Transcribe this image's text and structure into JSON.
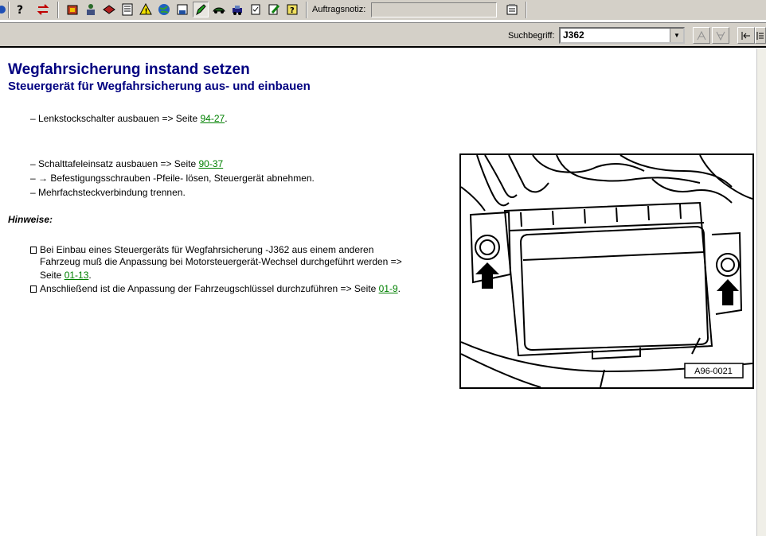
{
  "toolbar": {
    "auftragsnotiz_label": "Auftragsnotiz:",
    "auftragsnotiz_value": "",
    "icons": [
      "help-icon",
      "swap-icon",
      "box-icon",
      "person-icon",
      "book-icon",
      "document-icon",
      "warning-icon",
      "globe-icon",
      "save-icon",
      "pen-icon",
      "car-icon",
      "vehicle-icon",
      "checklist-icon",
      "edit-icon",
      "note-help-icon"
    ]
  },
  "search": {
    "label": "Suchbegriff:",
    "value": "J362"
  },
  "content": {
    "title": "Wegfahrsicherung instand setzen",
    "subtitle": "Steuergerät für Wegfahrsicherung aus- und einbauen",
    "steps": [
      {
        "text": "– Lenkstockschalter ausbauen => Seite ",
        "link": "94-27",
        "after": "."
      },
      {
        "text": "– Schalttafeleinsatz ausbauen => Seite ",
        "link": "90-37",
        "after": ""
      },
      {
        "text": "– → Befestigungsschrauben -Pfeile- lösen, Steuergerät abnehmen.",
        "link": "",
        "after": ""
      },
      {
        "text": "– Mehrfachsteckverbindung trennen.",
        "link": "",
        "after": ""
      }
    ],
    "hinweise_label": "Hinweise:",
    "notes": [
      {
        "line1": "Bei Einbau eines Steuergeräts für Wegfahrsicherung -J362 aus einem anderen",
        "line2": "Fahrzeug muß die Anpassung bei Motorsteuergerät-Wechsel durchgeführt werden =>",
        "line3": "Seite ",
        "link": "01-13",
        "after": "."
      },
      {
        "line1": "Anschließend ist die Anpassung der Fahrzeugschlüssel durchzuführen => Seite ",
        "link": "01-9",
        "after": "."
      }
    ],
    "figure_label": "A96-0021"
  }
}
